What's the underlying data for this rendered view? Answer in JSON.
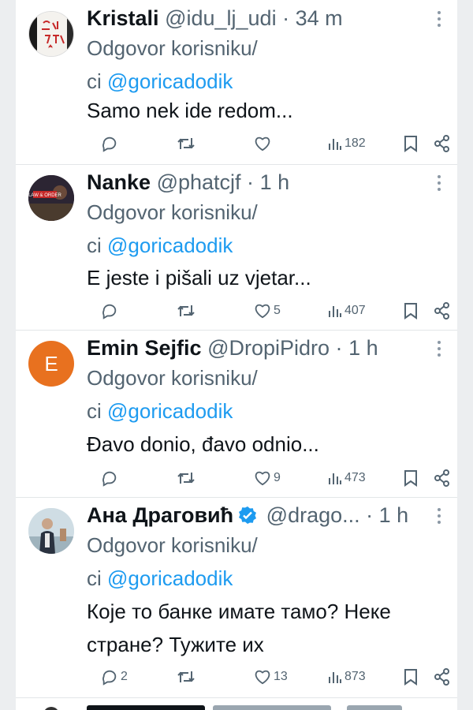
{
  "reply_label": "Odgovor korisniku/",
  "reply_prefix": "ci",
  "reply_mention": "@goricadodik",
  "tweets": [
    {
      "name": "Kristali",
      "handle": "@idu_lj_udi",
      "separator": "·",
      "time": "34 m",
      "text": "Samo nek ide redom...",
      "replies": "",
      "retweets": "",
      "likes": "",
      "views": "182",
      "avatar_text": "SALI SE TATI"
    },
    {
      "name": "Nanke",
      "handle": "@phatcjf",
      "separator": "·",
      "time": "1 h",
      "text": "E jeste i pišali uz vjetar...",
      "replies": "",
      "retweets": "",
      "likes": "5",
      "views": "407",
      "avatar_text": "LAW & ORDER"
    },
    {
      "name": "Emin Sejfic",
      "handle": "@DropiPidro",
      "separator": "·",
      "time": "1 h",
      "text": "Đavo donio, đavo odnio...",
      "replies": "",
      "retweets": "",
      "likes": "9",
      "views": "473",
      "avatar_text": "E"
    },
    {
      "name": "Ана Драговић",
      "handle": "@drago...",
      "separator": "·",
      "time": "1 h",
      "text_line1": "Које то банке имате тамо? Неке",
      "text_line2": "стране? Тужите их",
      "replies": "2",
      "retweets": "",
      "likes": "13",
      "views": "873"
    }
  ],
  "colors": {
    "text": "#0f1419",
    "secondary": "#536471",
    "link": "#1d9bf0",
    "verified": "#1d9bf0",
    "avatar_e": "#e8711f"
  }
}
